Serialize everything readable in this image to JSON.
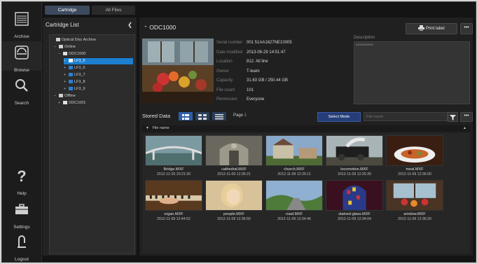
{
  "nav": {
    "archive": {
      "label": "Archive",
      "icon": "archive-icon"
    },
    "browse": {
      "label": "Browse",
      "icon": "disc-browse-icon"
    },
    "search": {
      "label": "Search",
      "icon": "search-icon"
    },
    "help": {
      "label": "Help",
      "icon": "question-icon"
    },
    "settings": {
      "label": "Settings",
      "icon": "toolbox-icon"
    },
    "logout": {
      "label": "Logout",
      "icon": "logout-icon"
    }
  },
  "tabs": {
    "cartridge": "Cartridge",
    "allfiles": "All Files"
  },
  "cartridge_list": {
    "title": "Cartridge List",
    "collapse_icon": "chevron-left-icon",
    "tree": [
      {
        "label": "Optical Disc Archive",
        "toggle": "",
        "icon": "archive"
      },
      {
        "label": "Online",
        "toggle": "−",
        "icon": "drive"
      },
      {
        "label": "ODC1000",
        "toggle": "−",
        "icon": "cart"
      },
      {
        "label": "LF3_5",
        "toggle": "+",
        "icon": "folder",
        "selected": true
      },
      {
        "label": "LF3_6",
        "toggle": "+",
        "icon": "folder"
      },
      {
        "label": "LF3_7",
        "toggle": "+",
        "icon": "folder"
      },
      {
        "label": "LF3_8",
        "toggle": "+",
        "icon": "folder"
      },
      {
        "label": "LF3_9",
        "toggle": "+",
        "icon": "folder"
      },
      {
        "label": "Offline",
        "toggle": "−",
        "icon": "grid"
      },
      {
        "label": "ODC1001",
        "toggle": "+",
        "icon": "cart"
      }
    ]
  },
  "detail": {
    "title": "ODC1000",
    "print_label": "Print label",
    "more": "•••",
    "fields": [
      {
        "key": "Serial number",
        "value": "001 51AA1627NE10005"
      },
      {
        "key": "Date modified",
        "value": "2013-06-29 14:51:47"
      },
      {
        "key": "Location",
        "value": "812. All line"
      },
      {
        "key": "Owner",
        "value": "T-team"
      },
      {
        "key": "Capacity",
        "value": "31.63 GB / 250.44 GB"
      },
      {
        "key": "File count",
        "value": "101"
      },
      {
        "key": "Permission",
        "value": "Everyone"
      }
    ],
    "description_label": "Description",
    "description": "xxxxxxxxxxx"
  },
  "stored": {
    "label": "Stored Data",
    "page_label": "Page",
    "page": "1",
    "select_mode": "Select Mode",
    "filter_placeholder": "File name",
    "sort_label": "File name",
    "accent": "#1c7fd0"
  },
  "files": [
    {
      "name": "Bridge.MXF",
      "date": "2012-12-26 20:21:30"
    },
    {
      "name": "cathedral.MXF",
      "date": "2012-11-09 12:36:21"
    },
    {
      "name": "church.MXF",
      "date": "2012-11-09 12:25:11"
    },
    {
      "name": "locomotive.MXF",
      "date": "2012-11-09 12:25:30"
    },
    {
      "name": "meal.MXF",
      "date": "2012-11-09 12:36:00"
    },
    {
      "name": "organ.MXF",
      "date": "2012-11-09 12:44:52"
    },
    {
      "name": "people.MXF",
      "date": "2012-11-09 12:36:50"
    },
    {
      "name": "road.MXF",
      "date": "2012-11-09 12:34:46"
    },
    {
      "name": "stained-glass.MXF",
      "date": "2012-11-09 12:34:04"
    },
    {
      "name": "window.MXF",
      "date": "2012-11-09 12:36:20"
    }
  ]
}
